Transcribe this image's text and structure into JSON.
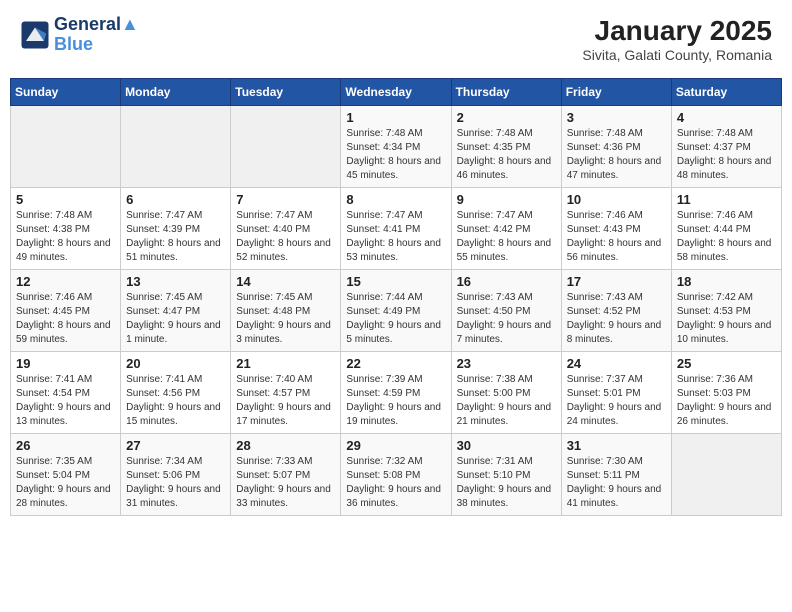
{
  "header": {
    "logo_line1": "General",
    "logo_line2": "Blue",
    "month_title": "January 2025",
    "location": "Sivita, Galati County, Romania"
  },
  "weekdays": [
    "Sunday",
    "Monday",
    "Tuesday",
    "Wednesday",
    "Thursday",
    "Friday",
    "Saturday"
  ],
  "weeks": [
    [
      {
        "day": "",
        "sunrise": "",
        "sunset": "",
        "daylight": ""
      },
      {
        "day": "",
        "sunrise": "",
        "sunset": "",
        "daylight": ""
      },
      {
        "day": "",
        "sunrise": "",
        "sunset": "",
        "daylight": ""
      },
      {
        "day": "1",
        "sunrise": "Sunrise: 7:48 AM",
        "sunset": "Sunset: 4:34 PM",
        "daylight": "Daylight: 8 hours and 45 minutes."
      },
      {
        "day": "2",
        "sunrise": "Sunrise: 7:48 AM",
        "sunset": "Sunset: 4:35 PM",
        "daylight": "Daylight: 8 hours and 46 minutes."
      },
      {
        "day": "3",
        "sunrise": "Sunrise: 7:48 AM",
        "sunset": "Sunset: 4:36 PM",
        "daylight": "Daylight: 8 hours and 47 minutes."
      },
      {
        "day": "4",
        "sunrise": "Sunrise: 7:48 AM",
        "sunset": "Sunset: 4:37 PM",
        "daylight": "Daylight: 8 hours and 48 minutes."
      }
    ],
    [
      {
        "day": "5",
        "sunrise": "Sunrise: 7:48 AM",
        "sunset": "Sunset: 4:38 PM",
        "daylight": "Daylight: 8 hours and 49 minutes."
      },
      {
        "day": "6",
        "sunrise": "Sunrise: 7:47 AM",
        "sunset": "Sunset: 4:39 PM",
        "daylight": "Daylight: 8 hours and 51 minutes."
      },
      {
        "day": "7",
        "sunrise": "Sunrise: 7:47 AM",
        "sunset": "Sunset: 4:40 PM",
        "daylight": "Daylight: 8 hours and 52 minutes."
      },
      {
        "day": "8",
        "sunrise": "Sunrise: 7:47 AM",
        "sunset": "Sunset: 4:41 PM",
        "daylight": "Daylight: 8 hours and 53 minutes."
      },
      {
        "day": "9",
        "sunrise": "Sunrise: 7:47 AM",
        "sunset": "Sunset: 4:42 PM",
        "daylight": "Daylight: 8 hours and 55 minutes."
      },
      {
        "day": "10",
        "sunrise": "Sunrise: 7:46 AM",
        "sunset": "Sunset: 4:43 PM",
        "daylight": "Daylight: 8 hours and 56 minutes."
      },
      {
        "day": "11",
        "sunrise": "Sunrise: 7:46 AM",
        "sunset": "Sunset: 4:44 PM",
        "daylight": "Daylight: 8 hours and 58 minutes."
      }
    ],
    [
      {
        "day": "12",
        "sunrise": "Sunrise: 7:46 AM",
        "sunset": "Sunset: 4:45 PM",
        "daylight": "Daylight: 8 hours and 59 minutes."
      },
      {
        "day": "13",
        "sunrise": "Sunrise: 7:45 AM",
        "sunset": "Sunset: 4:47 PM",
        "daylight": "Daylight: 9 hours and 1 minute."
      },
      {
        "day": "14",
        "sunrise": "Sunrise: 7:45 AM",
        "sunset": "Sunset: 4:48 PM",
        "daylight": "Daylight: 9 hours and 3 minutes."
      },
      {
        "day": "15",
        "sunrise": "Sunrise: 7:44 AM",
        "sunset": "Sunset: 4:49 PM",
        "daylight": "Daylight: 9 hours and 5 minutes."
      },
      {
        "day": "16",
        "sunrise": "Sunrise: 7:43 AM",
        "sunset": "Sunset: 4:50 PM",
        "daylight": "Daylight: 9 hours and 7 minutes."
      },
      {
        "day": "17",
        "sunrise": "Sunrise: 7:43 AM",
        "sunset": "Sunset: 4:52 PM",
        "daylight": "Daylight: 9 hours and 8 minutes."
      },
      {
        "day": "18",
        "sunrise": "Sunrise: 7:42 AM",
        "sunset": "Sunset: 4:53 PM",
        "daylight": "Daylight: 9 hours and 10 minutes."
      }
    ],
    [
      {
        "day": "19",
        "sunrise": "Sunrise: 7:41 AM",
        "sunset": "Sunset: 4:54 PM",
        "daylight": "Daylight: 9 hours and 13 minutes."
      },
      {
        "day": "20",
        "sunrise": "Sunrise: 7:41 AM",
        "sunset": "Sunset: 4:56 PM",
        "daylight": "Daylight: 9 hours and 15 minutes."
      },
      {
        "day": "21",
        "sunrise": "Sunrise: 7:40 AM",
        "sunset": "Sunset: 4:57 PM",
        "daylight": "Daylight: 9 hours and 17 minutes."
      },
      {
        "day": "22",
        "sunrise": "Sunrise: 7:39 AM",
        "sunset": "Sunset: 4:59 PM",
        "daylight": "Daylight: 9 hours and 19 minutes."
      },
      {
        "day": "23",
        "sunrise": "Sunrise: 7:38 AM",
        "sunset": "Sunset: 5:00 PM",
        "daylight": "Daylight: 9 hours and 21 minutes."
      },
      {
        "day": "24",
        "sunrise": "Sunrise: 7:37 AM",
        "sunset": "Sunset: 5:01 PM",
        "daylight": "Daylight: 9 hours and 24 minutes."
      },
      {
        "day": "25",
        "sunrise": "Sunrise: 7:36 AM",
        "sunset": "Sunset: 5:03 PM",
        "daylight": "Daylight: 9 hours and 26 minutes."
      }
    ],
    [
      {
        "day": "26",
        "sunrise": "Sunrise: 7:35 AM",
        "sunset": "Sunset: 5:04 PM",
        "daylight": "Daylight: 9 hours and 28 minutes."
      },
      {
        "day": "27",
        "sunrise": "Sunrise: 7:34 AM",
        "sunset": "Sunset: 5:06 PM",
        "daylight": "Daylight: 9 hours and 31 minutes."
      },
      {
        "day": "28",
        "sunrise": "Sunrise: 7:33 AM",
        "sunset": "Sunset: 5:07 PM",
        "daylight": "Daylight: 9 hours and 33 minutes."
      },
      {
        "day": "29",
        "sunrise": "Sunrise: 7:32 AM",
        "sunset": "Sunset: 5:08 PM",
        "daylight": "Daylight: 9 hours and 36 minutes."
      },
      {
        "day": "30",
        "sunrise": "Sunrise: 7:31 AM",
        "sunset": "Sunset: 5:10 PM",
        "daylight": "Daylight: 9 hours and 38 minutes."
      },
      {
        "day": "31",
        "sunrise": "Sunrise: 7:30 AM",
        "sunset": "Sunset: 5:11 PM",
        "daylight": "Daylight: 9 hours and 41 minutes."
      },
      {
        "day": "",
        "sunrise": "",
        "sunset": "",
        "daylight": ""
      }
    ]
  ]
}
